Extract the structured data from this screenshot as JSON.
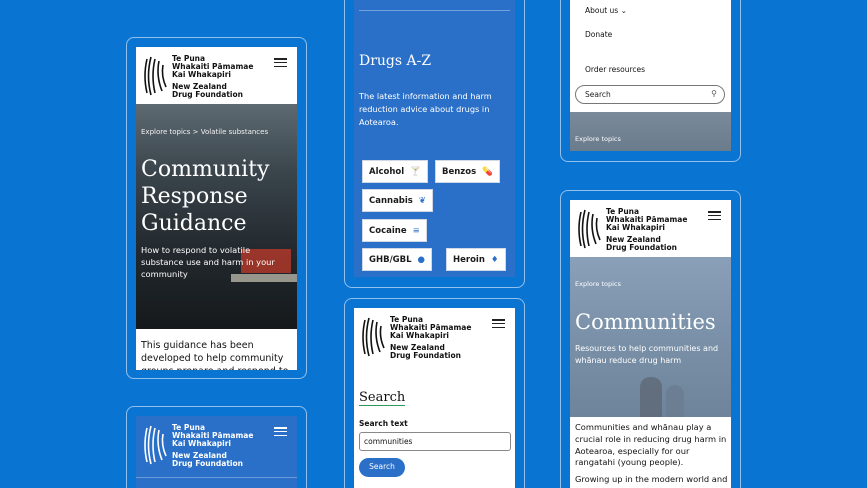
{
  "brand": {
    "line1": "Te Puna",
    "line2": "Whakaiti Pāmamae",
    "line3": "Kai Whakapiri",
    "line4": "New Zealand",
    "line5": "Drug Foundation"
  },
  "colors": {
    "background": "#0a74d3",
    "accent_blue": "#2a6fc8",
    "underline_green": "#2e9a59"
  },
  "card_guidance": {
    "breadcrumb": "Explore topics  >  Volatile substances",
    "title": "Community Response Guidance",
    "subtitle": "How to respond to volatile substance use and harm in your community",
    "body": "This guidance has been developed to help community groups prepare and respond to"
  },
  "card_drugs": {
    "title": "Drugs A-Z",
    "description": "The latest information and harm reduction advice about drugs in Aotearoa.",
    "chips": [
      {
        "label": "Alcohol",
        "icon": "glass-icon"
      },
      {
        "label": "Benzos",
        "icon": "pill-icon"
      },
      {
        "label": "Cannabis",
        "icon": "leaf-icon"
      },
      {
        "label": "Cocaine",
        "icon": "lines-icon"
      },
      {
        "label": "GHB/GBL",
        "icon": "drop-icon"
      },
      {
        "label": "Heroin",
        "icon": "poppy-icon"
      }
    ]
  },
  "card_menu": {
    "about": "About us",
    "donate": "Donate",
    "order": "Order resources",
    "search_placeholder": "Search",
    "explore": "Explore topics"
  },
  "card_search": {
    "title": "Search",
    "label": "Search text",
    "value": "communities",
    "button": "Search"
  },
  "card_communities": {
    "explore": "Explore topics",
    "title": "Communities",
    "subtitle": "Resources to help communities and whānau reduce drug harm",
    "body1": "Communities and whānau play a crucial role in reducing drug harm in Aotearoa, especially for our rangatahi (young people).",
    "body2": "Growing up in the modern world and"
  }
}
